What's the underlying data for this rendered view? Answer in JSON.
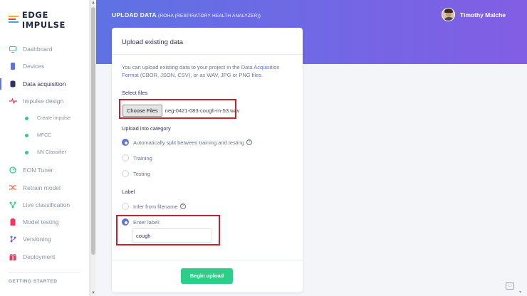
{
  "app": {
    "logo_text": "EDGE IMPULSE",
    "accent_color": "#5e72e4",
    "success_color": "#2dce89",
    "highlight_color": "#cf1f2c"
  },
  "sidebar": {
    "items": [
      {
        "label": "Dashboard",
        "icon": "monitor-icon",
        "active": false
      },
      {
        "label": "Devices",
        "icon": "devices-icon",
        "active": false
      },
      {
        "label": "Data acquisition",
        "icon": "database-icon",
        "active": true
      },
      {
        "label": "Impulse design",
        "icon": "pulse-icon",
        "active": false
      },
      {
        "label": "Create impulse",
        "icon": "green-dot-icon",
        "sub": true
      },
      {
        "label": "MFCC",
        "icon": "green-dot-icon",
        "sub": true
      },
      {
        "label": "NN Classifier",
        "icon": "green-dot-icon",
        "sub": true
      },
      {
        "label": "EON Tuner",
        "icon": "tuner-icon",
        "active": false
      },
      {
        "label": "Retrain model",
        "icon": "shuffle-icon",
        "active": false
      },
      {
        "label": "Live classification",
        "icon": "tree-icon",
        "active": false
      },
      {
        "label": "Model testing",
        "icon": "clipboard-icon",
        "active": false
      },
      {
        "label": "Versioning",
        "icon": "branch-icon",
        "active": false
      },
      {
        "label": "Deployment",
        "icon": "gift-icon",
        "active": false
      }
    ],
    "section_label": "GETTING STARTED"
  },
  "header": {
    "title": "UPLOAD DATA",
    "subtitle": "(ROHA (RESPIRATORY HEALTH ANALYZER))",
    "user_name": "Timothy Malche"
  },
  "card": {
    "title": "Upload existing data",
    "description_prefix": "You can upload existing data to your project in the ",
    "description_link": "Data Acquisition Format",
    "description_suffix": " (CBOR, JSON, CSV), or as WAV, JPG or PNG files.",
    "select_files_label": "Select files",
    "choose_files_button": "Choose Files",
    "file_name": "neg-0421-083-cough-m-53.wav",
    "category_label": "Upload into category",
    "category_options": [
      {
        "label": "Automatically split between training and testing",
        "checked": true,
        "help": true
      },
      {
        "label": "Training",
        "checked": false
      },
      {
        "label": "Testing",
        "checked": false
      }
    ],
    "label_section": "Label",
    "label_options": [
      {
        "label": "Infer from filename",
        "checked": false,
        "help": true
      },
      {
        "label": "Enter label:",
        "checked": true
      }
    ],
    "label_value": "cough",
    "submit_button": "Begin upload"
  }
}
